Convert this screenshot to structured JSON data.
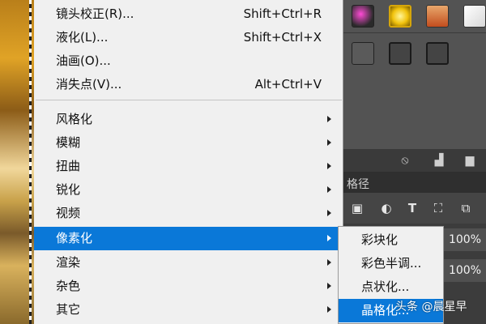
{
  "menu": {
    "items": [
      {
        "label": "镜头校正(R)...",
        "shortcut": "Shift+Ctrl+R"
      },
      {
        "label": "液化(L)...",
        "shortcut": "Shift+Ctrl+X"
      },
      {
        "label": "油画(O)...",
        "shortcut": ""
      },
      {
        "label": "消失点(V)...",
        "shortcut": "Alt+Ctrl+V"
      },
      {
        "label": "风格化",
        "shortcut": ""
      },
      {
        "label": "模糊",
        "shortcut": ""
      },
      {
        "label": "扭曲",
        "shortcut": ""
      },
      {
        "label": "锐化",
        "shortcut": ""
      },
      {
        "label": "视频",
        "shortcut": ""
      },
      {
        "label": "像素化",
        "shortcut": ""
      },
      {
        "label": "渲染",
        "shortcut": ""
      },
      {
        "label": "杂色",
        "shortcut": ""
      },
      {
        "label": "其它",
        "shortcut": ""
      }
    ],
    "active_item": "像素化"
  },
  "submenu": {
    "items": [
      {
        "label": "彩块化"
      },
      {
        "label": "彩色半调..."
      },
      {
        "label": "点状化..."
      },
      {
        "label": "晶格化..."
      }
    ],
    "active_item": "晶格化..."
  },
  "panel": {
    "tab_label": "格径",
    "opacity_1": "100%",
    "opacity_2": "100%",
    "tools": [
      "image-icon",
      "adjustment-icon",
      "type-icon",
      "transform-icon",
      "smart-object-icon"
    ]
  },
  "watermark": "头条 @晨星早",
  "colors": {
    "menu_bg": "#f0f0f0",
    "highlight": "#0a78d8",
    "panel_dark": "#3c3c3c"
  }
}
